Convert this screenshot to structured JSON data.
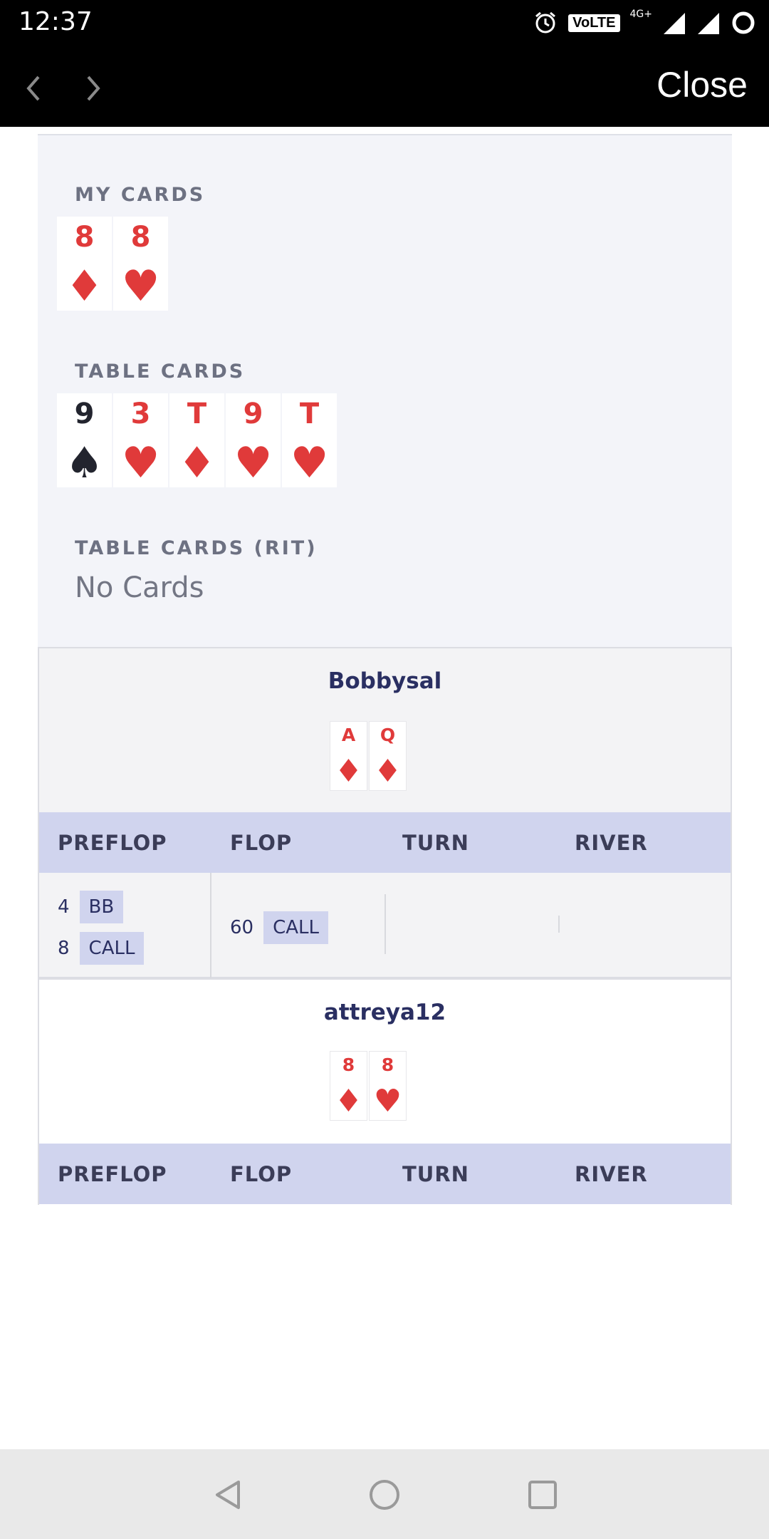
{
  "status_bar": {
    "time": "12:37",
    "volte": "VoLTE",
    "network": "4G+"
  },
  "nav": {
    "close_label": "Close"
  },
  "my_cards": {
    "label": "MY CARDS",
    "cards": [
      {
        "rank": "8",
        "suit": "♦",
        "color": "red"
      },
      {
        "rank": "8",
        "suit": "♥",
        "color": "red"
      }
    ]
  },
  "table_cards": {
    "label": "TABLE CARDS",
    "cards": [
      {
        "rank": "9",
        "suit": "♠",
        "color": "black"
      },
      {
        "rank": "3",
        "suit": "♥",
        "color": "red"
      },
      {
        "rank": "T",
        "suit": "♦",
        "color": "red"
      },
      {
        "rank": "9",
        "suit": "♥",
        "color": "red"
      },
      {
        "rank": "T",
        "suit": "♥",
        "color": "red"
      }
    ]
  },
  "table_cards_rit": {
    "label": "TABLE CARDS (RIT)",
    "empty_text": "No Cards"
  },
  "players": [
    {
      "name": "Bobbysal",
      "cards": [
        {
          "rank": "A",
          "suit": "♦"
        },
        {
          "rank": "Q",
          "suit": "♦"
        }
      ],
      "streets": [
        "PREFLOP",
        "FLOP",
        "TURN",
        "RIVER"
      ],
      "actions": {
        "preflop": [
          {
            "amount": "4",
            "action": "BB"
          },
          {
            "amount": "8",
            "action": "CALL"
          }
        ],
        "flop": [
          {
            "amount": "60",
            "action": "CALL"
          }
        ]
      }
    },
    {
      "name": "attreya12",
      "cards": [
        {
          "rank": "8",
          "suit": "♦"
        },
        {
          "rank": "8",
          "suit": "♥"
        }
      ],
      "streets": [
        "PREFLOP",
        "FLOP",
        "TURN",
        "RIVER"
      ]
    }
  ],
  "colors": {
    "red_suit": "#e03a3a",
    "black_suit": "#22242e",
    "header_bg": "#d0d4ee",
    "name_color": "#2a2f62"
  }
}
